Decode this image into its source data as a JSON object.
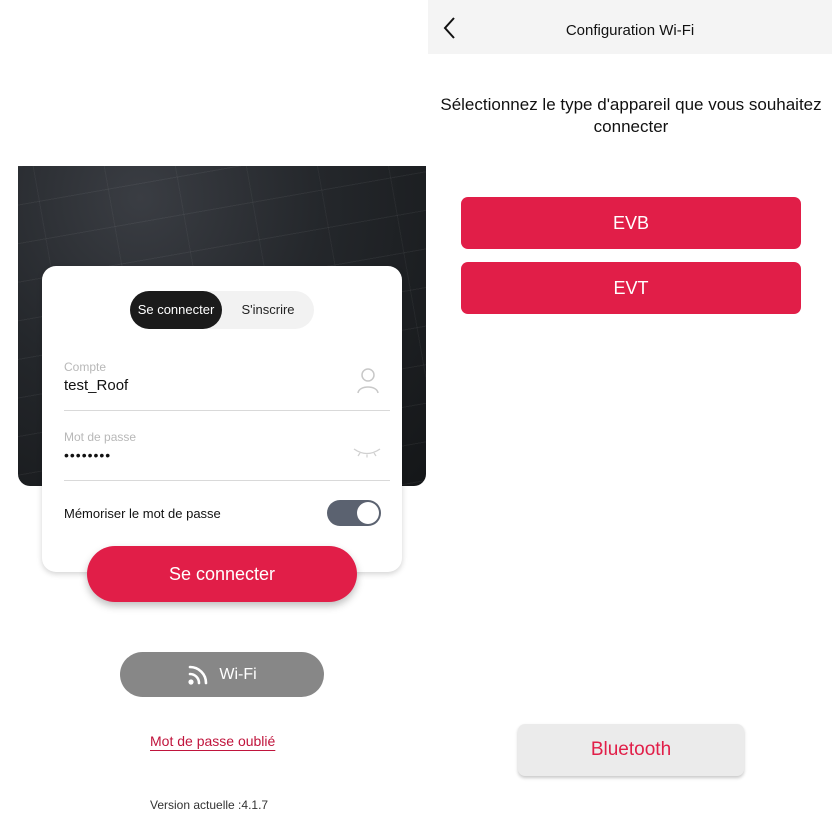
{
  "login": {
    "tab_login": "Se connecter",
    "tab_register": "S'inscrire",
    "account_label": "Compte",
    "account_value": "test_Roof",
    "password_label": "Mot de passe",
    "password_value": "••••••••",
    "remember_label": "Mémoriser le mot de passe",
    "remember_enabled": true,
    "connect_button": "Se connecter",
    "wifi_button": "Wi-Fi",
    "forgot_password": "Mot de passe oublié",
    "version": "Version actuelle :4.1.7",
    "icons": [
      "user-icon",
      "eye-closed-icon",
      "wifi-icon"
    ]
  },
  "wifi_config": {
    "title": "Configuration Wi-Fi",
    "prompt": "Sélectionnez le type d'appareil que vous souhaitez connecter",
    "device_types": [
      "EVB",
      "EVT"
    ],
    "bluetooth_button": "Bluetooth",
    "icons": [
      "back-chevron-icon"
    ]
  },
  "colors": {
    "accent": "#e11e48",
    "toggle_on": "#5b6270",
    "wifi_button_bg": "#878787"
  }
}
